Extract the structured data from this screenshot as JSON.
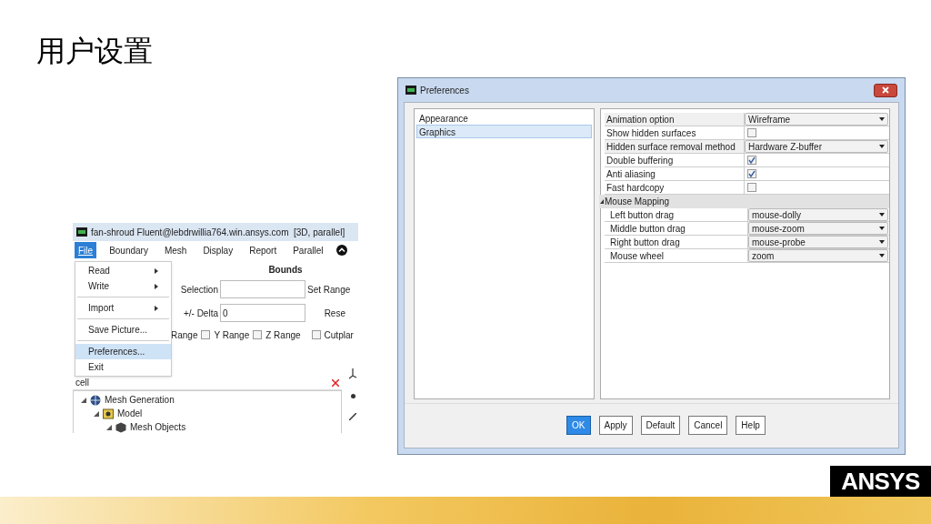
{
  "slide_title": "用户设置",
  "fluent_window": {
    "title": "fan-shroud Fluent@lebdrwillia764.win.ansys.com  [3D, parallel]",
    "menu": [
      {
        "label": "File",
        "selected": true
      },
      {
        "label": "Boundary",
        "selected": false
      },
      {
        "label": "Mesh",
        "selected": false
      },
      {
        "label": "Display",
        "selected": false
      },
      {
        "label": "Report",
        "selected": false
      },
      {
        "label": "Parallel",
        "selected": false
      }
    ],
    "file_menu": [
      {
        "kind": "item",
        "label": "Read",
        "submenu": true,
        "selected": false
      },
      {
        "kind": "item",
        "label": "Write",
        "submenu": true,
        "selected": false
      },
      {
        "kind": "separator"
      },
      {
        "kind": "item",
        "label": "Import",
        "submenu": true,
        "selected": false
      },
      {
        "kind": "separator"
      },
      {
        "kind": "item",
        "label": "Save Picture...",
        "submenu": false,
        "selected": false
      },
      {
        "kind": "separator"
      },
      {
        "kind": "item",
        "label": "Preferences...",
        "submenu": false,
        "selected": true
      },
      {
        "kind": "item",
        "label": "Exit",
        "submenu": false,
        "selected": false
      }
    ],
    "bounds_heading": "Bounds",
    "fields": [
      {
        "label": "Selection",
        "side": "Set Range"
      },
      {
        "label": "+/- Delta",
        "value": "0",
        "side": "Rese"
      }
    ],
    "ranges": [
      {
        "label": "Range"
      },
      {
        "label": "Y Range",
        "checked": false
      },
      {
        "label": "Z Range",
        "checked": false
      },
      {
        "label": "Cutplar",
        "checked": false
      }
    ],
    "search": {
      "value": "cell"
    },
    "tree": [
      {
        "label": "Mesh Generation",
        "expanded": true,
        "children": [
          {
            "label": "Model",
            "expanded": true,
            "children": [
              {
                "label": "Mesh Objects",
                "expanded": true
              }
            ]
          }
        ]
      }
    ]
  },
  "dialog": {
    "title": "Preferences",
    "categories": [
      {
        "label": "Appearance",
        "selected": false
      },
      {
        "label": "Graphics",
        "selected": true
      }
    ],
    "properties": [
      {
        "kind": "dropdown",
        "label": "Animation option",
        "value": "Wireframe"
      },
      {
        "kind": "checkbox",
        "label": "Show hidden surfaces",
        "checked": false
      },
      {
        "kind": "dropdown",
        "label": "Hidden surface removal method",
        "value": "Hardware Z-buffer"
      },
      {
        "kind": "checkbox",
        "label": "Double buffering",
        "checked": true
      },
      {
        "kind": "checkbox",
        "label": "Anti aliasing",
        "checked": true
      },
      {
        "kind": "checkbox",
        "label": "Fast hardcopy",
        "checked": false
      },
      {
        "kind": "group",
        "label": "Mouse Mapping",
        "expanded": true,
        "children": [
          {
            "kind": "dropdown",
            "label": "Left button drag",
            "value": "mouse-dolly"
          },
          {
            "kind": "dropdown",
            "label": "Middle button drag",
            "value": "mouse-zoom"
          },
          {
            "kind": "dropdown",
            "label": "Right button drag",
            "value": "mouse-probe"
          },
          {
            "kind": "dropdown",
            "label": "Mouse wheel",
            "value": "zoom"
          }
        ]
      }
    ],
    "buttons": [
      {
        "label": "OK",
        "default": true
      },
      {
        "label": "Apply",
        "default": false
      },
      {
        "label": "Default",
        "default": false
      },
      {
        "label": "Cancel",
        "default": false
      },
      {
        "label": "Help",
        "default": false
      }
    ]
  },
  "logo": {
    "text": "ANSYS"
  }
}
